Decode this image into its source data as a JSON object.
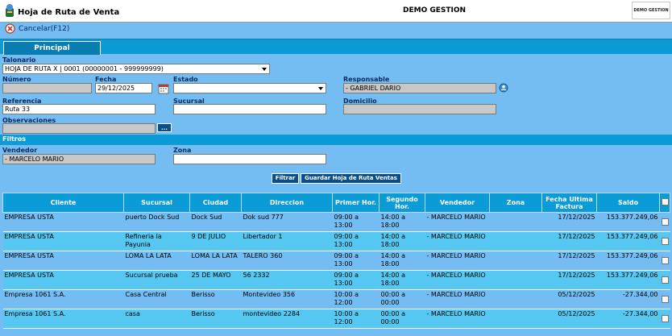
{
  "header": {
    "app_title": "Hoja de Ruta de Venta",
    "company": "DEMO GESTION",
    "company_logo": "DEMO GESTION"
  },
  "toolbar": {
    "cancel_label": "Cancelar(F12)",
    "cancel_icon": "cancel-icon"
  },
  "tabs": [
    {
      "label": "Principal",
      "active": true
    }
  ],
  "form": {
    "talonario_label": "Talonario",
    "talonario_value": "HOJA DE RUTA X | 0001 (00000001 - 999999999)",
    "numero_label": "Número",
    "numero_value": "",
    "fecha_label": "Fecha",
    "fecha_value": "29/12/2025",
    "estado_label": "Estado",
    "estado_value": "",
    "responsable_label": "Responsable",
    "responsable_value": "- GABRIEL DARIO",
    "referencia_label": "Referencia",
    "referencia_value": "Ruta 33",
    "sucursal_label": "Sucursal",
    "sucursal_value": "",
    "domicilio_label": "Domicilio",
    "domicilio_value": "",
    "observaciones_label": "Observaciones",
    "observaciones_value": "",
    "obs_btn": "..."
  },
  "filters": {
    "title": "Filtros",
    "vendedor_label": "Vendedor",
    "vendedor_value": "- MARCELO MARIO",
    "zona_label": "Zona",
    "zona_value": "",
    "filter_btn": "Filtrar",
    "save_btn": "Guardar Hoja de Ruta Ventas"
  },
  "table": {
    "headers": [
      "Cliente",
      "Sucursal",
      "Ciudad",
      "Direccion",
      "Primer Hor.",
      "Segundo Hor.",
      "Vendedor",
      "Zona",
      "Fecha Ultima Factura",
      "Saldo"
    ],
    "rows": [
      [
        "EMPRESA USTA",
        "puerto Dock Sud",
        "Dock Sud",
        "Dok sud 777",
        "09:00 a 13:00",
        "14:00 a 18:00",
        "- MARCELO MARIO",
        "",
        "17/12/2025",
        "153.377.249,06"
      ],
      [
        "EMPRESA USTA",
        "Refineria la Payunia",
        "9 DE JULIO",
        "Libertador 1",
        "09:00 a 13:00",
        "14:00 a 18:00",
        "- MARCELO MARIO",
        "",
        "17/12/2025",
        "153.377.249,06"
      ],
      [
        "EMPRESA USTA",
        "LOMA LA LATA",
        "LOMA LA LATA",
        "TALERO 360",
        "09:00 a 13:00",
        "14:00 a 18:00",
        "- MARCELO MARIO",
        "",
        "17/12/2025",
        "153.377.249,06"
      ],
      [
        "EMPRESA USTA",
        "Sucursal prueba",
        "25 DE MAYO",
        "56 2332",
        "09:00 a 13:00",
        "14:00 a 18:00",
        "- MARCELO MARIO",
        "",
        "17/12/2025",
        "153.377.249,06"
      ],
      [
        "Empresa 1061 S.A.",
        "Casa Central",
        "Berisso",
        "Montevideo 356",
        "10:00 a 12:00",
        "00:00 a 00:00",
        "- MARCELO MARIO",
        "",
        "05/12/2025",
        "-27.344,00"
      ],
      [
        "Empresa 1061 S.A.",
        "casa",
        "Berisso",
        "montevideo 2284",
        "10:00 a 12:00",
        "00:00 a 00:00",
        "- MARCELO MARIO",
        "",
        "05/12/2025",
        "-27.344,00"
      ]
    ]
  },
  "colors": {
    "background": "#73bdf2",
    "band": "#0b9bd6",
    "button": "#0a4f8a"
  }
}
